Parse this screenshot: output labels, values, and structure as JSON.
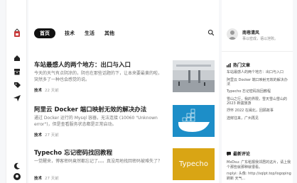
{
  "nav": {
    "tabs": [
      {
        "label": "首页"
      },
      {
        "label": "技术"
      },
      {
        "label": "生活"
      },
      {
        "label": "其他"
      }
    ]
  },
  "posts": [
    {
      "title": "车站最感人的两个地方：出口与入口",
      "excerpt": "今天的天气有点阴凉的，阴也在那些话题的下，让本来要最黄的啦，突然多了一种也会感觉的说。",
      "category": "技术",
      "time": "22 天前"
    },
    {
      "title": "阿里云 Docker 端口映射无效的解决办法",
      "excerpt": "通过 Docker 运行的 Mysql 容器，无法连接 (10060 \"Unknown error\")，但是查看服务状态都是正常启动。",
      "category": "技术",
      "time": "27 天前"
    },
    {
      "title": "Typecho 忘记密码找回教程",
      "excerpt": "一觉醒来，博客密码竟然都忘记了。。。真没用地找回密码被难失了？",
      "category": "技术",
      "time": "27 天前",
      "thumb_text": "Typecho"
    }
  ],
  "profile": {
    "name": "南巷清风",
    "desc": "事以密成，语以泄败。"
  },
  "hot": {
    "heading": "热门文章",
    "items": [
      "车站最感人的两个地方：出口与入口",
      "阿里云 Docker 端口映射无效的解决办法",
      "Typecho 忘记密码找回教程",
      "雪山之行，我的界限，雪天雪山雪山的2023 新疆旅游",
      "抒怀 2022 在闽北，回顾故事",
      "选鲜往来，广州再见"
    ]
  },
  "comments": {
    "heading": "最新评论",
    "items": [
      "MxDsu: 广东稻报我邻居的这片，请上我个那些就那种就很看。",
      "rsplyi: 头像: http://sqlpt.top/logoping刷新 天气..."
    ]
  },
  "colors": {
    "accent": "#111111",
    "typecho_bg": "#d9a514",
    "docker_bg": "#1d8ec8"
  }
}
